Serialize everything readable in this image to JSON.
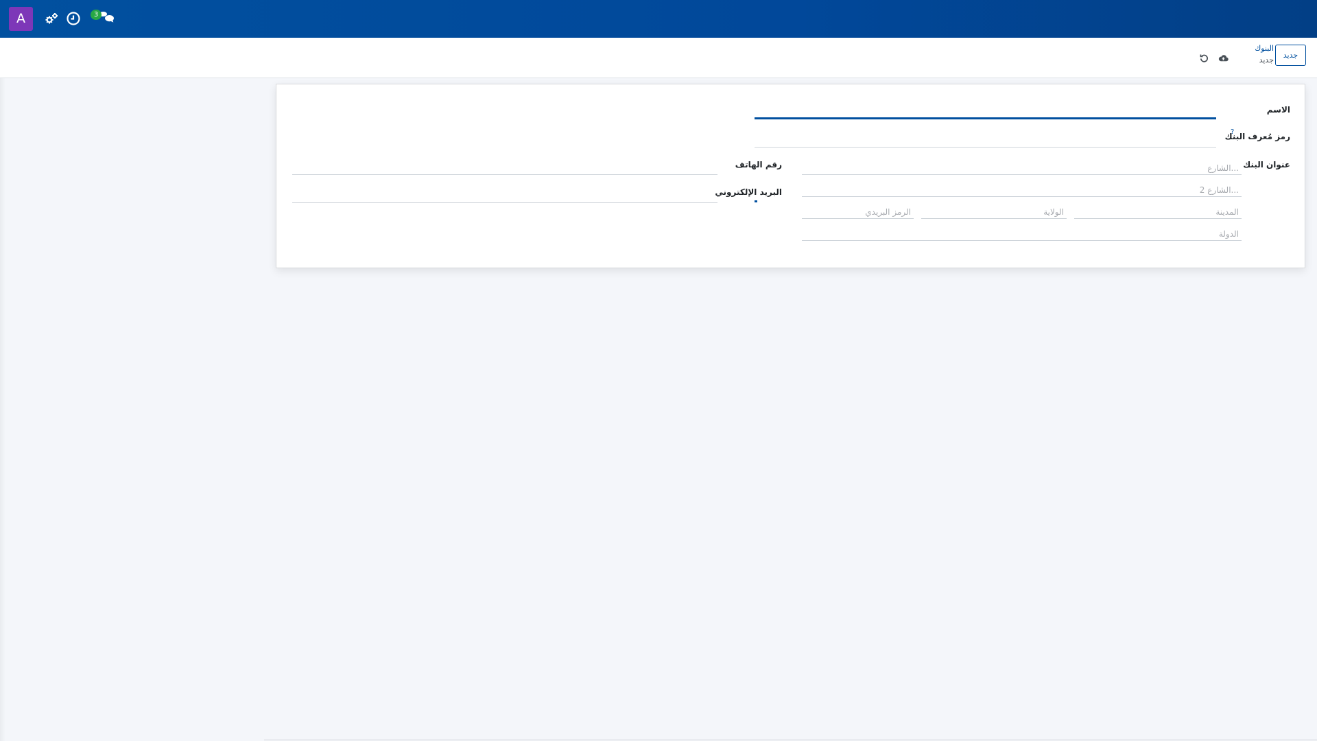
{
  "navbar": {
    "avatar_letter": "A",
    "chat_badge": "3",
    "icons": [
      "cogs-icon",
      "clock-icon",
      "chat-icon"
    ],
    "colors": {
      "bar": "#01509f",
      "avatar": "#7d37b8",
      "badge": "#28a745"
    }
  },
  "control_panel": {
    "new_button": "جديد",
    "breadcrumb_parent": "البنوك",
    "breadcrumb_current": "جديد",
    "icons": [
      "cloud-upload-icon",
      "undo-icon"
    ]
  },
  "form": {
    "name_label": "الاسم",
    "name_value": "",
    "bic_label": "رمز مُعرف البنك",
    "bic_help": "?",
    "bic_value": "",
    "address_label": "عنوان البنك",
    "street_placeholder": "الشارع...",
    "street2_placeholder": "الشارع 2...",
    "city_placeholder": "المدينة",
    "state_placeholder": "الولاية",
    "zip_placeholder": "الرمز البريدي",
    "country_placeholder": "الدولة",
    "phone_label": "رقم الهاتف",
    "phone_value": "",
    "email_label": "البريد الإلكتروني",
    "email_value": ""
  }
}
